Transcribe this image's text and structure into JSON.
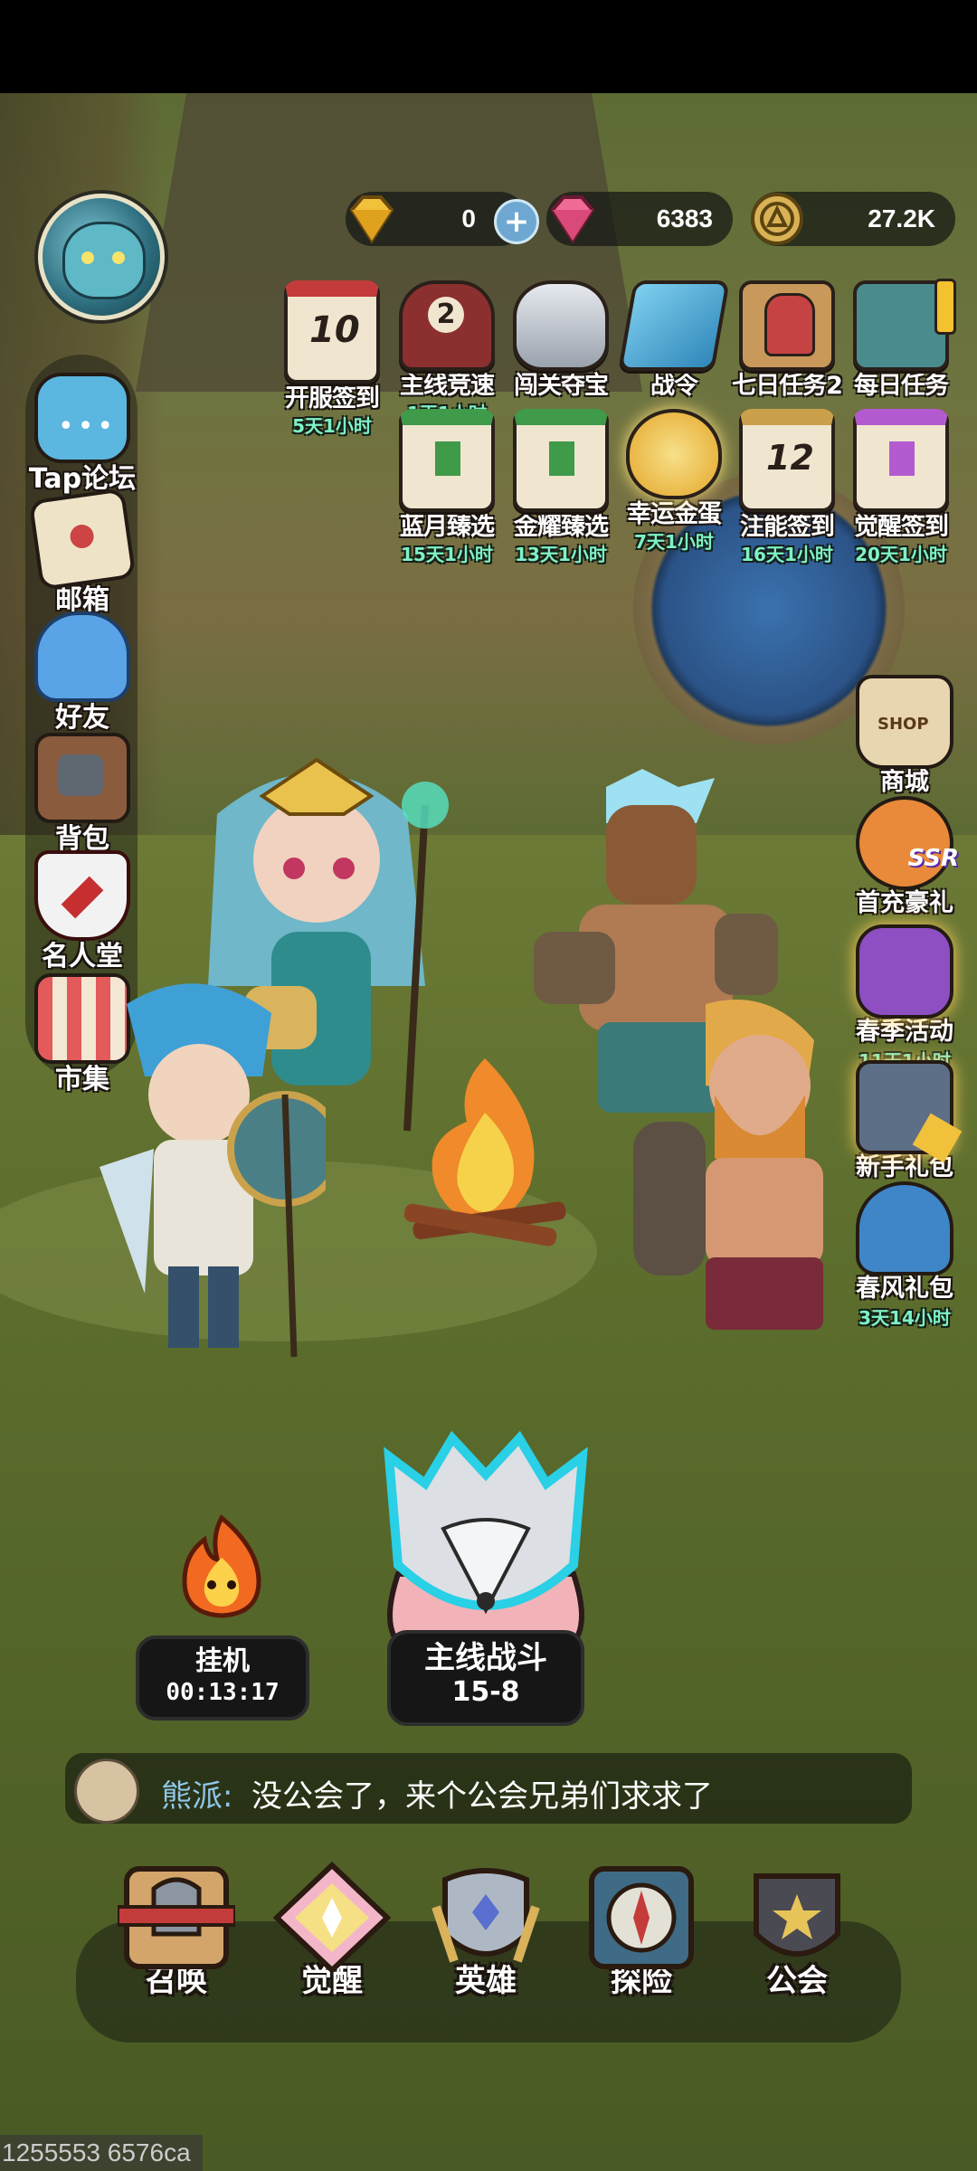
{
  "currency": {
    "gold_gem": "0",
    "pink_gem": "6383",
    "coin": "27.2K"
  },
  "events_row1": [
    {
      "label": "开服签到",
      "time": "5天1小时"
    },
    {
      "label": "主线竞速",
      "time": "1天1小时",
      "badge": "2"
    },
    {
      "label": "闯关夺宝",
      "time": ""
    },
    {
      "label": "战令",
      "time": ""
    },
    {
      "label": "七日任务2",
      "time": ""
    },
    {
      "label": "每日任务",
      "time": ""
    }
  ],
  "events_row2": [
    {
      "label": "蓝月臻选",
      "time": "15天1小时"
    },
    {
      "label": "金耀臻选",
      "time": "13天1小时"
    },
    {
      "label": "幸运金蛋",
      "time": "7天1小时"
    },
    {
      "label": "注能签到",
      "time": "16天1小时"
    },
    {
      "label": "觉醒签到",
      "time": "20天1小时"
    }
  ],
  "left_menu": [
    {
      "label": "Tap论坛"
    },
    {
      "label": "邮箱"
    },
    {
      "label": "好友"
    },
    {
      "label": "背包"
    },
    {
      "label": "名人堂"
    },
    {
      "label": "市集"
    }
  ],
  "right_menu": [
    {
      "label": "商城",
      "time": ""
    },
    {
      "label": "首充豪礼",
      "time": ""
    },
    {
      "label": "春季活动",
      "time": "11天1小时"
    },
    {
      "label": "新手礼包",
      "time": ""
    },
    {
      "label": "春风礼包",
      "time": "3天14小时"
    }
  ],
  "shop_sign": "SHOP",
  "ssr_tag": "SSR",
  "idle": {
    "label": "挂机",
    "timer": "00:13:17"
  },
  "battle": {
    "label": "主线战斗",
    "stage": "15-8"
  },
  "chat": {
    "name": "熊派:",
    "message": "没公会了，来个公会兄弟们求求了"
  },
  "bottom_nav": [
    {
      "label": "召唤",
      "icon": "summon-icon"
    },
    {
      "label": "觉醒",
      "icon": "awaken-icon"
    },
    {
      "label": "英雄",
      "icon": "hero-icon"
    },
    {
      "label": "探险",
      "icon": "explore-icon"
    },
    {
      "label": "公会",
      "icon": "guild-icon"
    }
  ],
  "debug_text": "1255553 6576ca",
  "colors": {
    "timer_green": "#7ef2c5",
    "chat_name": "#8fc6e8"
  }
}
